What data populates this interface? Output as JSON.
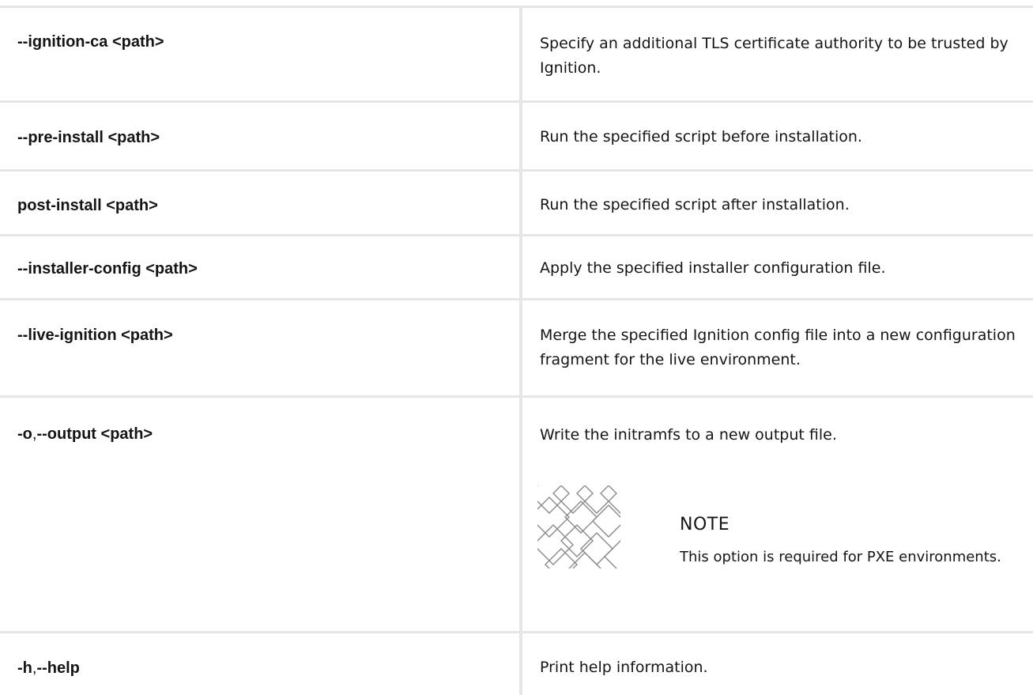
{
  "table": {
    "rows": [
      {
        "option_parts": [
          "--ignition-ca <path>"
        ],
        "description": "Specify an additional TLS certificate authority to be trusted by Ignition."
      },
      {
        "option_parts": [
          "--pre-install <path>"
        ],
        "description": "Run the specified script before installation."
      },
      {
        "option_parts": [
          "post-install <path>"
        ],
        "description": "Run the specified script after installation."
      },
      {
        "option_parts": [
          "--installer-config <path>"
        ],
        "description": "Apply the specified installer configuration file."
      },
      {
        "option_parts": [
          "--live-ignition <path>"
        ],
        "description": "Merge the specified Ignition config file into a new configuration fragment for the live environment."
      },
      {
        "option_parts": [
          "-o",
          ",",
          "--output <path>"
        ],
        "description": "Write the initramfs to a new output file.",
        "note": {
          "icon": "note-pattern-icon",
          "heading": "NOTE",
          "text": "This option is required for PXE environments."
        }
      },
      {
        "option_parts": [
          "-h",
          ",",
          "--help"
        ],
        "description": "Print help information."
      }
    ]
  },
  "colors": {
    "border": "#e6e6e6",
    "text": "#151515",
    "icon_stroke": "#8a8a8a"
  }
}
